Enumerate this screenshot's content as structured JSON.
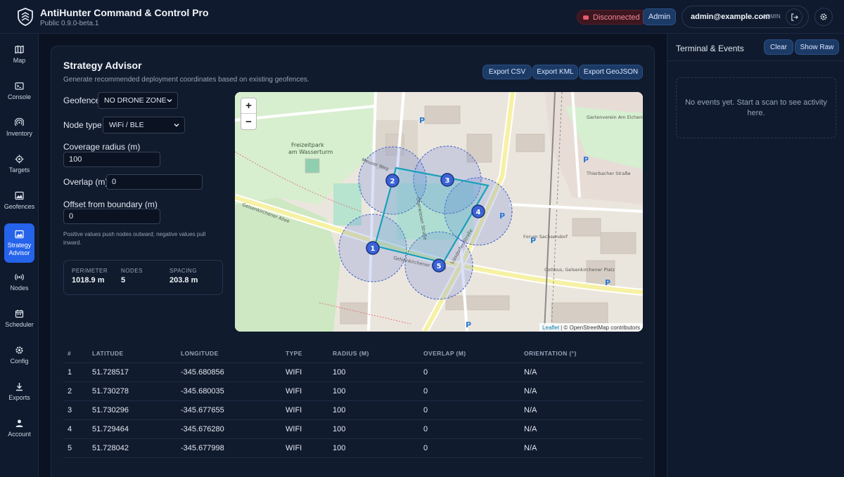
{
  "app": {
    "title": "AntiHunter Command & Control Pro",
    "version": "Public 0.9.0-beta.1"
  },
  "header": {
    "status": "Disconnected",
    "role_button": "Admin",
    "user_email": "admin@example.com",
    "user_role": "ADMIN"
  },
  "sidebar": {
    "items": [
      {
        "label": "Map",
        "icon": "map-icon"
      },
      {
        "label": "Console",
        "icon": "terminal-icon"
      },
      {
        "label": "Inventory",
        "icon": "radar-icon"
      },
      {
        "label": "Targets",
        "icon": "crosshair-icon"
      },
      {
        "label": "Geofences",
        "icon": "landscape-icon"
      },
      {
        "label": "Strategy Advisor",
        "icon": "landscape-icon",
        "active": true
      },
      {
        "label": "Nodes",
        "icon": "broadcast-icon"
      },
      {
        "label": "Scheduler",
        "icon": "calendar-icon"
      },
      {
        "label": "Config",
        "icon": "gear-icon"
      },
      {
        "label": "Exports",
        "icon": "download-icon"
      },
      {
        "label": "Account",
        "icon": "user-icon"
      }
    ]
  },
  "strategy": {
    "title": "Strategy Advisor",
    "subtitle": "Generate recommended deployment coordinates based on existing geofences.",
    "exports": {
      "csv": "Export CSV",
      "kml": "Export KML",
      "geojson": "Export GeoJSON"
    },
    "form": {
      "geofence_label": "Geofence",
      "geofence_value": "NO DRONE ZONE",
      "node_type_label": "Node type",
      "node_type_value": "WiFi / BLE",
      "radius_label": "Coverage radius (m)",
      "radius_value": "100",
      "overlap_label": "Overlap (m)",
      "overlap_value": "0",
      "offset_label": "Offset from boundary (m)",
      "offset_value": "0",
      "hint": "Positive values push nodes outward; negative values pull inward."
    },
    "stats": {
      "perimeter_label": "PERIMETER",
      "perimeter": "1018.9 m",
      "nodes_label": "NODES",
      "nodes": "5",
      "spacing_label": "SPACING",
      "spacing": "203.8 m"
    },
    "map": {
      "zoom_in": "+",
      "zoom_out": "−",
      "attribution_link": "Leaflet",
      "attribution_text": "| © OpenStreetMap contributors",
      "labels": {
        "park": "Freizeitpark",
        "park2": "am Wasserturm",
        "street1": "Gelsenkirchener Allee",
        "street2": "Gelsenkirchener Straße",
        "street3": "Meuser Weg",
        "street4": "Oberwiesen Straße",
        "street5": "Lipsdorfer Straße",
        "place1": "Forum Sachsendorf",
        "place2": "Cottbus, Gelsenkirchener Platz",
        "place3": "Gartenverein Am Eichenhain",
        "place4": "Thierbacher Straße"
      },
      "markers": [
        "1",
        "2",
        "3",
        "4",
        "5"
      ]
    },
    "table": {
      "headers": [
        "#",
        "LATITUDE",
        "LONGITUDE",
        "TYPE",
        "RADIUS (M)",
        "OVERLAP (M)",
        "ORIENTATION (°)"
      ],
      "rows": [
        [
          "1",
          "51.728517",
          "-345.680856",
          "WIFI",
          "100",
          "0",
          "N/A"
        ],
        [
          "2",
          "51.730278",
          "-345.680035",
          "WIFI",
          "100",
          "0",
          "N/A"
        ],
        [
          "3",
          "51.730296",
          "-345.677655",
          "WIFI",
          "100",
          "0",
          "N/A"
        ],
        [
          "4",
          "51.729464",
          "-345.676280",
          "WIFI",
          "100",
          "0",
          "N/A"
        ],
        [
          "5",
          "51.728042",
          "-345.677998",
          "WIFI",
          "100",
          "0",
          "N/A"
        ]
      ]
    }
  },
  "terminal": {
    "title": "Terminal & Events",
    "clear": "Clear",
    "show_raw": "Show Raw",
    "empty": "No events yet. Start a scan to see activity here."
  },
  "colors": {
    "accent": "#2563eb",
    "danger": "#e65a6d",
    "marker": "#3b63d6"
  }
}
